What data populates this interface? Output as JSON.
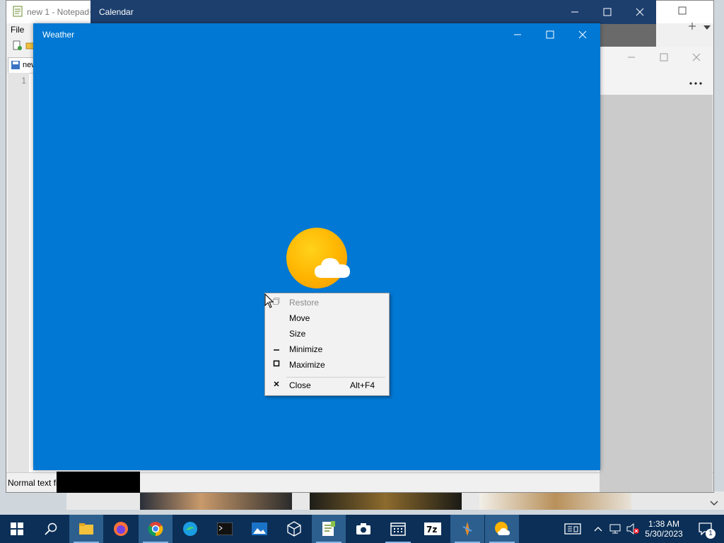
{
  "notepad": {
    "title": "new 1 - Notepad++",
    "menu_file": "File",
    "tab_label": "new 1",
    "line_number": "1",
    "status_text": "Normal text file"
  },
  "calendar": {
    "title": "Calendar"
  },
  "weather": {
    "title": "Weather"
  },
  "context_menu": {
    "items": [
      {
        "label": "Restore",
        "icon": "restore-icon",
        "disabled": true
      },
      {
        "label": "Move"
      },
      {
        "label": "Size"
      },
      {
        "label": "Minimize",
        "icon": "minimize-icon"
      },
      {
        "label": "Maximize",
        "icon": "maximize-icon"
      },
      {
        "label": "Close",
        "icon": "close-icon",
        "accelerator": "Alt+F4"
      }
    ]
  },
  "taskbar": {
    "apps": [
      "start",
      "search",
      "file-explorer",
      "firefox",
      "chrome",
      "edge",
      "terminal",
      "photos",
      "3d-viewer",
      "notepad++",
      "camera",
      "calendar",
      "7zip",
      "tool",
      "weather"
    ],
    "clock_time": "1:38 AM",
    "clock_date": "5/30/2023",
    "notification_count": "1"
  },
  "colors": {
    "weather_bg": "#0078d4",
    "taskbar_bg": "#0b2f57",
    "calendar_title_bg": "#1d3f6e"
  }
}
